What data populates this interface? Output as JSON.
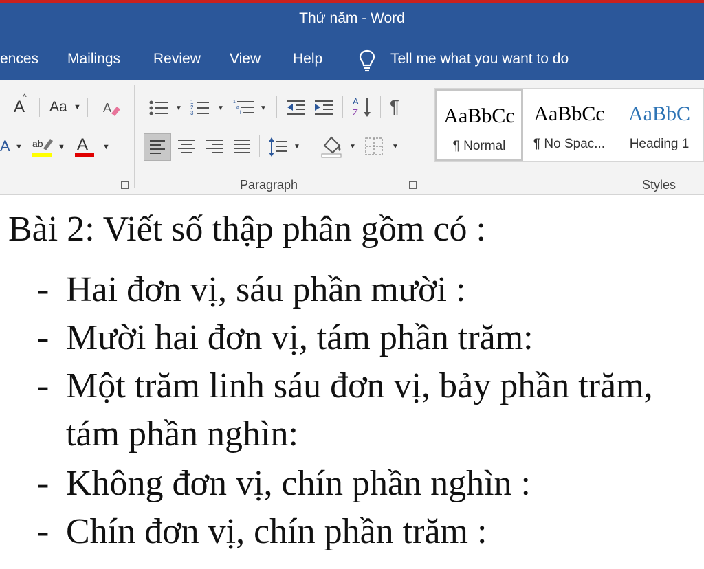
{
  "window": {
    "title": "Thứ năm  -  Word"
  },
  "tabs": [
    "ences",
    "Mailings",
    "Review",
    "View",
    "Help"
  ],
  "tell_me": "Tell me what you want to do",
  "ribbon": {
    "font_group": {
      "case_label": "Aa",
      "grow_label": "A"
    },
    "paragraph_group": {
      "label": "Paragraph"
    },
    "styles_group": {
      "label": "Styles",
      "items": [
        {
          "preview": "AaBbCc",
          "name": "¶ Normal",
          "selected": true
        },
        {
          "preview": "AaBbCc",
          "name": "¶ No Spac..."
        },
        {
          "preview": "AaBbC",
          "name": "Heading 1"
        }
      ]
    }
  },
  "document": {
    "heading": "Bài 2: Viết số thập phân gồm có :",
    "items": [
      "Hai đơn vị, sáu phần mười :",
      "Mười hai đơn vị, tám phần trăm:",
      "Một trăm linh sáu đơn vị, bảy phần trăm,",
      "tám phần nghìn:",
      "Không đơn vị, chín phần nghìn :",
      "Chín đơn vị, chín phần trăm :"
    ]
  },
  "colors": {
    "title_bar": "#2b579a",
    "highlight": "#ffff00",
    "font_color": "#e00000",
    "heading_style": "#2e74b5"
  }
}
